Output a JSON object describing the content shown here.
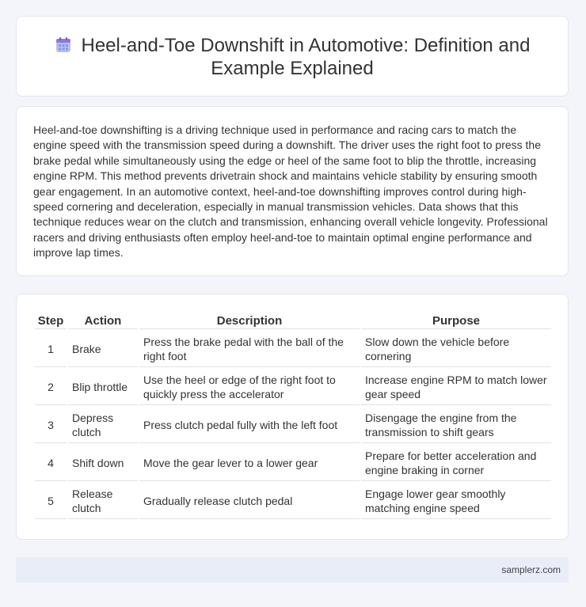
{
  "header": {
    "icon": "calendar-grid-icon",
    "title": "Heel-and-Toe Downshift in Automotive: Definition and Example Explained"
  },
  "intro": {
    "text": "Heel-and-toe downshifting is a driving technique used in performance and racing cars to match the engine speed with the transmission speed during a downshift. The driver uses the right foot to press the brake pedal while simultaneously using the edge or heel of the same foot to blip the throttle, increasing engine RPM. This method prevents drivetrain shock and maintains vehicle stability by ensuring smooth gear engagement. In an automotive context, heel-and-toe downshifting improves control during high-speed cornering and deceleration, especially in manual transmission vehicles. Data shows that this technique reduces wear on the clutch and transmission, enhancing overall vehicle longevity. Professional racers and driving enthusiasts often employ heel-and-toe to maintain optimal engine performance and improve lap times."
  },
  "table": {
    "headers": [
      "Step",
      "Action",
      "Description",
      "Purpose"
    ],
    "rows": [
      {
        "step": "1",
        "action": "Brake",
        "description": "Press the brake pedal with the ball of the right foot",
        "purpose": "Slow down the vehicle before cornering"
      },
      {
        "step": "2",
        "action": "Blip throttle",
        "description": "Use the heel or edge of the right foot to quickly press the accelerator",
        "purpose": "Increase engine RPM to match lower gear speed"
      },
      {
        "step": "3",
        "action": "Depress clutch",
        "description": "Press clutch pedal fully with the left foot",
        "purpose": "Disengage the engine from the transmission to shift gears"
      },
      {
        "step": "4",
        "action": "Shift down",
        "description": "Move the gear lever to a lower gear",
        "purpose": "Prepare for better acceleration and engine braking in corner"
      },
      {
        "step": "5",
        "action": "Release clutch",
        "description": "Gradually release clutch pedal",
        "purpose": "Engage lower gear smoothly matching engine speed"
      }
    ]
  },
  "footer": {
    "site": "samplerz.com"
  }
}
